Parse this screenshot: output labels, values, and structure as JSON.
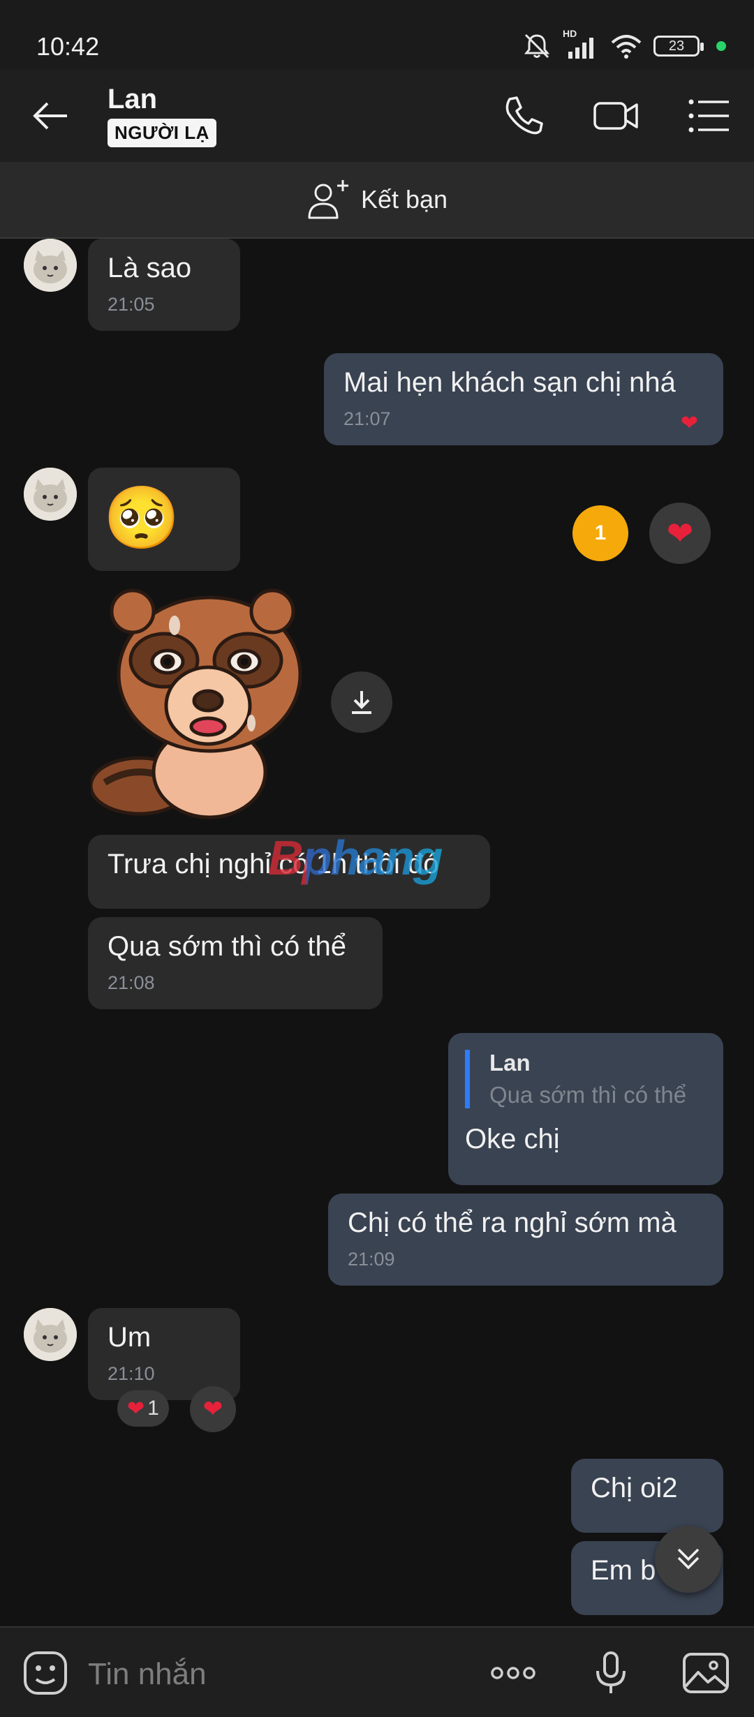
{
  "status": {
    "time": "10:42",
    "battery": "23",
    "network_label": "HD"
  },
  "header": {
    "name": "Lan",
    "badge": "NGƯỜI LẠ"
  },
  "add_friend": {
    "label": "Kết bạn"
  },
  "messages": [
    {
      "text": "Là sao",
      "time": "21:05"
    },
    {
      "text": "Mai hẹn khách sạn chị nhá",
      "time": "21:07"
    },
    {
      "emoji": "🥺",
      "reaction_count": "1"
    },
    {
      "text": "Trưa chị nghỉ có 1h thôi đó"
    },
    {
      "text": "Qua sớm thì có thể",
      "time": "21:08"
    },
    {
      "reply_name": "Lan",
      "reply_text": "Qua sớm thì có thể",
      "text": "Oke chị"
    },
    {
      "text": "Chị có thể ra nghỉ sớm mà",
      "time": "21:09"
    },
    {
      "text": "Um",
      "time": "21:10",
      "reaction_count": "1"
    },
    {
      "text": "Chị oi2"
    },
    {
      "text": "Em b"
    }
  ],
  "watermark": {
    "text": "Bphang"
  },
  "input": {
    "placeholder": "Tin nhắn"
  },
  "colors": {
    "accent": "#2f7cf6",
    "outgoing_bubble": "#3a4352",
    "incoming_bubble": "#2b2b2b",
    "reaction_badge": "#f5a90a"
  }
}
